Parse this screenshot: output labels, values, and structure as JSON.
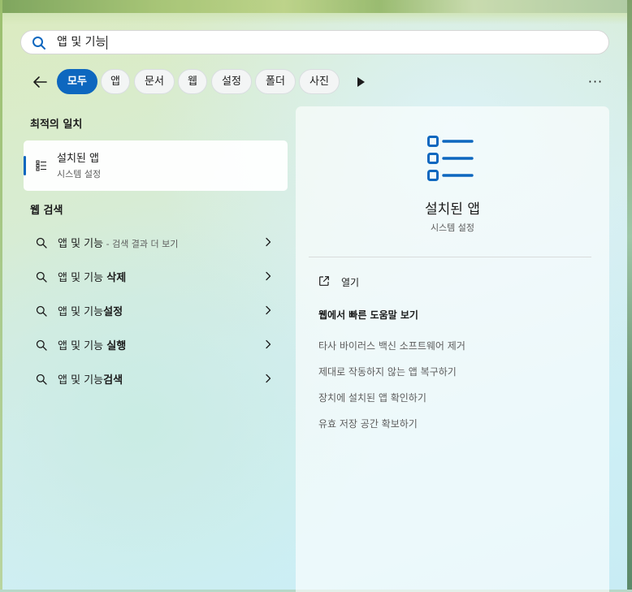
{
  "search": {
    "query": "앱 및 기능"
  },
  "filters": {
    "chips": [
      "모두",
      "앱",
      "문서",
      "웹",
      "설정",
      "폴더",
      "사진"
    ],
    "active": "모두"
  },
  "best_match": {
    "header": "최적의 일치",
    "title": "설치된 앱",
    "subtitle": "시스템 설정"
  },
  "web_search": {
    "header": "웹 검색",
    "results": [
      {
        "prefix": "앱 및 기능",
        "bold": "",
        "suffix": " - 검색 결과 더 보기"
      },
      {
        "prefix": "앱 및 기능 ",
        "bold": "삭제",
        "suffix": ""
      },
      {
        "prefix": "앱 및 기능",
        "bold": "설정",
        "suffix": ""
      },
      {
        "prefix": "앱 및 기능 ",
        "bold": "실행",
        "suffix": ""
      },
      {
        "prefix": "앱 및 기능",
        "bold": "검색",
        "suffix": ""
      }
    ]
  },
  "preview": {
    "title": "설치된 앱",
    "subtitle": "시스템 설정",
    "open_label": "열기",
    "help_header": "웹에서 빠른 도움말 보기",
    "help_links": [
      "타사 바이러스 백신 소프트웨어 제거",
      "제대로 작동하지 않는 앱 복구하기",
      "장치에 설치된 앱 확인하기",
      "유효 저장 공간 확보하기"
    ]
  },
  "colors": {
    "accent": "#0d67bf"
  }
}
